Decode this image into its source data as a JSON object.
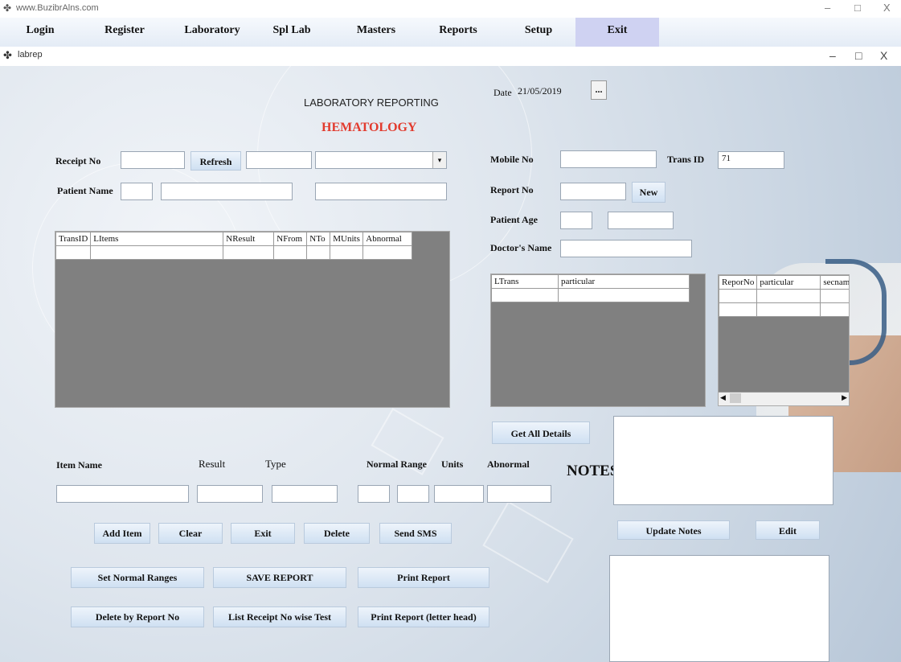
{
  "app": {
    "title": "www.BuzibrAlns.com"
  },
  "menu": [
    {
      "label": "Login"
    },
    {
      "label": "Register"
    },
    {
      "label": "Laboratory"
    },
    {
      "label": "Spl Lab"
    },
    {
      "label": "Masters"
    },
    {
      "label": "Reports"
    },
    {
      "label": "Setup"
    },
    {
      "label": "Exit"
    }
  ],
  "child_window": {
    "title": "labrep"
  },
  "window_controls": {
    "minimize": "–",
    "maximize": "□",
    "close": "X"
  },
  "header": {
    "title": "LABORATORY REPORTING",
    "section": "HEMATOLOGY",
    "date_label": "Date",
    "date_value": "21/05/2019",
    "date_button": "..."
  },
  "form": {
    "receipt_no_label": "Receipt No",
    "refresh_label": "Refresh",
    "patient_name_label": "Patient Name",
    "mobile_no_label": "Mobile No",
    "trans_id_label": "Trans ID",
    "trans_id_value": "71",
    "report_no_label": "Report No",
    "new_label": "New",
    "patient_age_label": "Patient Age",
    "doctors_name_label": "Doctor's Name",
    "dropdown_arrow": "▾"
  },
  "items_grid": {
    "columns": [
      "TransID",
      "LItems",
      "NResult",
      "NFrom",
      "NTo",
      "MUnits",
      "Abnormal"
    ]
  },
  "ltrans_grid": {
    "columns": [
      "LTrans",
      "particular"
    ]
  },
  "report_grid": {
    "columns": [
      "ReporNo",
      "particular",
      "secnam"
    ],
    "scroll_left": "◀",
    "scroll_right": "▶"
  },
  "entry": {
    "item_name_label": "Item Name",
    "result_label": "Result",
    "type_label": "Type",
    "normal_range_label": "Normal Range",
    "units_label": "Units",
    "abnormal_label": "Abnormal"
  },
  "buttons": {
    "add_item": "Add Item",
    "clear": "Clear",
    "exit": "Exit",
    "delete": "Delete",
    "send_sms": "Send SMS",
    "set_normal_ranges": "Set Normal Ranges",
    "save_report": "SAVE REPORT",
    "print_report": "Print Report",
    "delete_by_report_no": "Delete by Report No",
    "list_receipt_no_wise_test": "List Receipt No wise Test",
    "print_report_letter_head": "Print Report (letter head)",
    "get_all_details": "Get All Details",
    "update_notes": "Update Notes",
    "edit": "Edit"
  },
  "notes": {
    "label": "NOTES:"
  }
}
